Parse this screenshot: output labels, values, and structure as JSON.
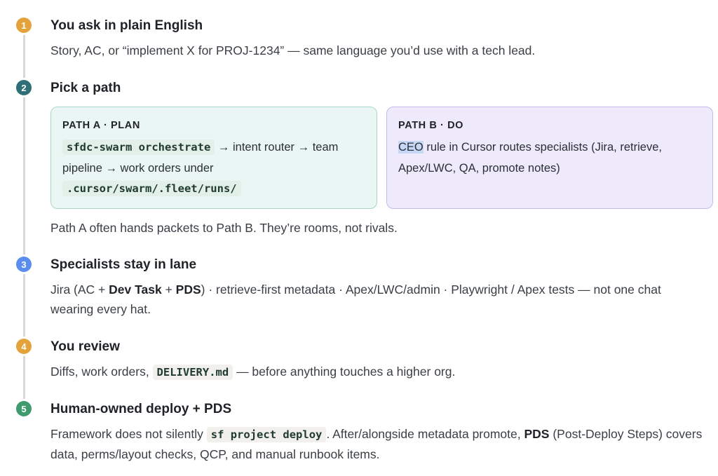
{
  "steps": [
    {
      "number": "1",
      "title": "You ask in plain English",
      "description": "Story, AC, or “implement X for PROJ-1234” — same language you’d use with a tech lead.",
      "color": "#E3A33A"
    },
    {
      "number": "2",
      "title": "Pick a path",
      "color": "#2F6F78",
      "path_a": {
        "label": "PATH A · PLAN",
        "code1": "sfdc-swarm orchestrate",
        "text1": " → intent router → team pipeline → work orders under ",
        "code2": ".cursor/swarm/.fleet/runs/"
      },
      "path_b": {
        "label": "PATH B · DO",
        "highlight": "CEO",
        "text": " rule in Cursor routes specialists (Jira, retrieve, Apex/LWC, QA, promote notes)"
      },
      "note": "Path A often hands packets to Path B. They’re rooms, not rivals."
    },
    {
      "number": "3",
      "title": "Specialists stay in lane",
      "color": "#5B8DEF",
      "desc_parts": {
        "t1": "Jira (AC + ",
        "b1": "Dev Task",
        "t2": " + ",
        "b2": "PDS",
        "t3": ") · retrieve-first metadata · Apex/LWC/admin · Playwright / Apex tests — not one chat wearing every hat."
      }
    },
    {
      "number": "4",
      "title": "You review",
      "color": "#E3A33A",
      "desc_parts": {
        "t1": "Diffs, work orders, ",
        "code": "DELIVERY.md",
        "t2": " — before anything touches a higher org."
      }
    },
    {
      "number": "5",
      "title": "Human-owned deploy + PDS",
      "color": "#3F9B6E",
      "desc_parts": {
        "t1": "Framework does not silently ",
        "code": "sf project deploy",
        "t2": ". After/alongside metadata promote, ",
        "b1": "PDS",
        "t3": " (Post-Deploy Steps) covers data, perms/layout checks, QCP, and manual runbook items."
      }
    }
  ]
}
